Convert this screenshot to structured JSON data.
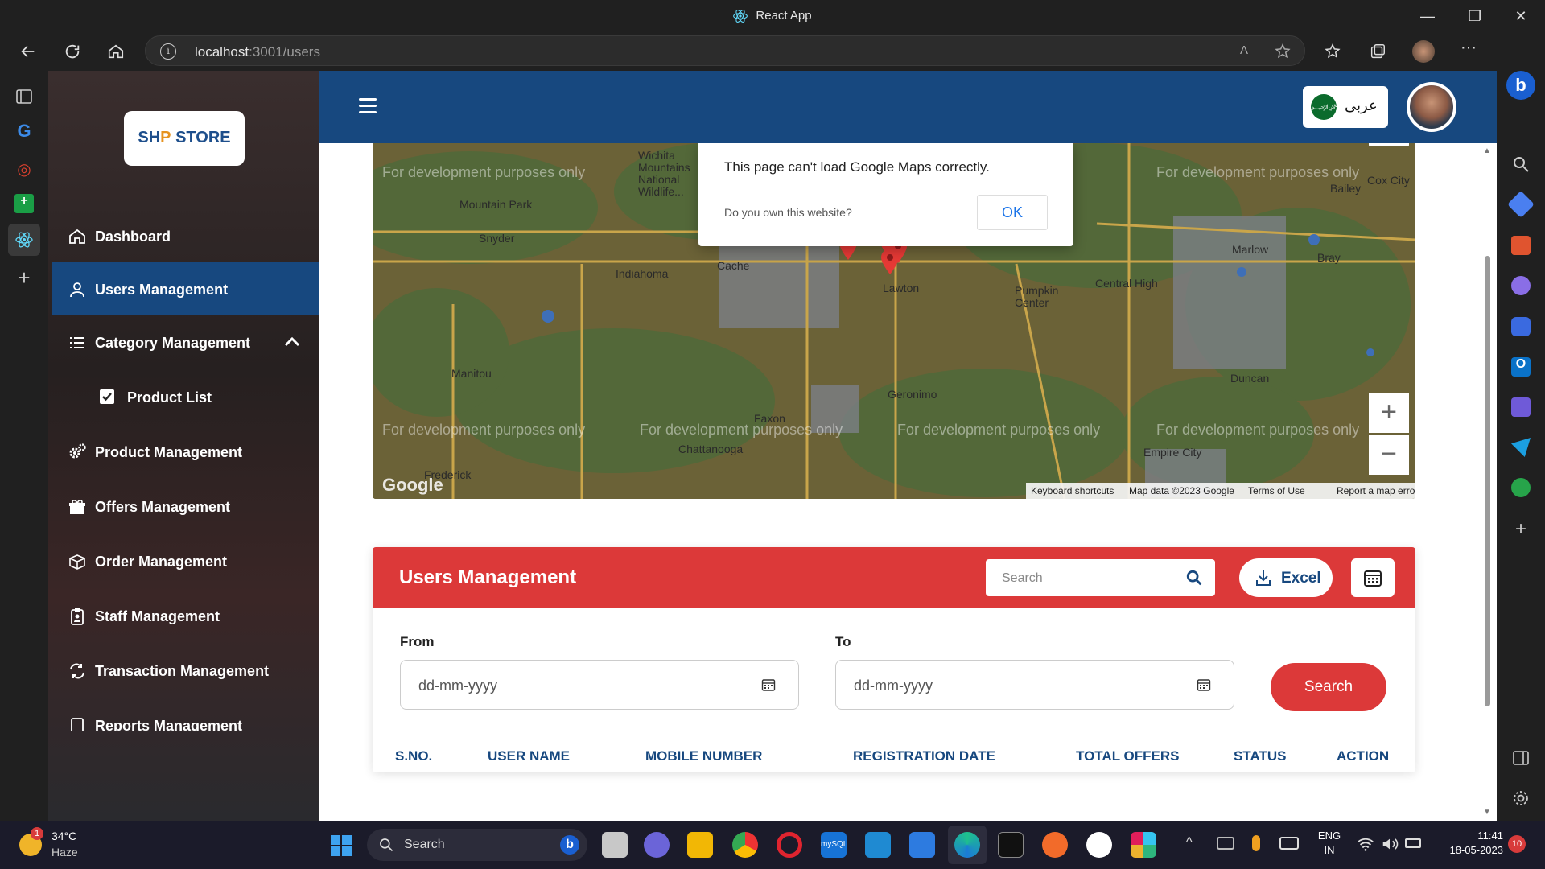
{
  "browser": {
    "window_title": "React App",
    "url_host": "localhost",
    "url_rest": ":3001/users"
  },
  "app": {
    "logo_text_a": "SH",
    "logo_text_b": "P",
    "logo_text_c": " STORE",
    "language_label": "عربى",
    "flag_text": "﷽"
  },
  "sidebar": {
    "items": [
      {
        "label": "Dashboard",
        "icon": "home-icon"
      },
      {
        "label": "Users Management",
        "icon": "user-icon",
        "active": true
      },
      {
        "label": "Category Management",
        "icon": "list-icon",
        "expanded": true
      },
      {
        "label": "Product List",
        "icon": "checkbox-icon",
        "child": true
      },
      {
        "label": "Product Management",
        "icon": "gears-icon"
      },
      {
        "label": "Offers Management",
        "icon": "gift-icon"
      },
      {
        "label": "Order Management",
        "icon": "box-icon"
      },
      {
        "label": "Staff Management",
        "icon": "clipboard-user-icon"
      },
      {
        "label": "Transaction Management",
        "icon": "exchange-icon"
      },
      {
        "label": "Reports Management",
        "icon": "report-icon"
      }
    ]
  },
  "map": {
    "watermark": "For development purposes only",
    "towns": [
      "Wichita Mountains National Wildlife...",
      "Mountain Park",
      "Snyder",
      "Indiahoma",
      "Cache",
      "Lawton",
      "Pumpkin Center",
      "Central High",
      "Marlow",
      "Bray",
      "Bailey",
      "Cox City",
      "Manitou",
      "Duncan",
      "Geronimo",
      "Faxon",
      "Chattanooga",
      "Frederick",
      "Empire City"
    ],
    "alert_message": "This page can't load Google Maps correctly.",
    "alert_question": "Do you own this website?",
    "alert_ok": "OK",
    "google_logo": "Google",
    "footer": {
      "shortcuts": "Keyboard shortcuts",
      "data": "Map data ©2023 Google",
      "terms": "Terms of Use",
      "report": "Report a map error"
    },
    "zoom_in": "+",
    "zoom_out": "−"
  },
  "users_card": {
    "title": "Users Management",
    "search_placeholder": "Search",
    "excel_label": "Excel",
    "from_label": "From",
    "to_label": "To",
    "date_placeholder": "dd-mm-yyyy",
    "search_button": "Search",
    "columns": [
      "S.NO.",
      "USER NAME",
      "MOBILE NUMBER",
      "REGISTRATION DATE",
      "TOTAL OFFERS",
      "STATUS",
      "ACTION"
    ]
  },
  "taskbar": {
    "weather_temp": "34°C",
    "weather_cond": "Haze",
    "weather_badge": "1",
    "search_label": "Search",
    "lang_line1": "ENG",
    "lang_line2": "IN",
    "time": "11:41",
    "date": "18-05-2023",
    "notif_count": "10"
  },
  "colors": {
    "primary": "#17487f",
    "danger": "#dc3939"
  }
}
